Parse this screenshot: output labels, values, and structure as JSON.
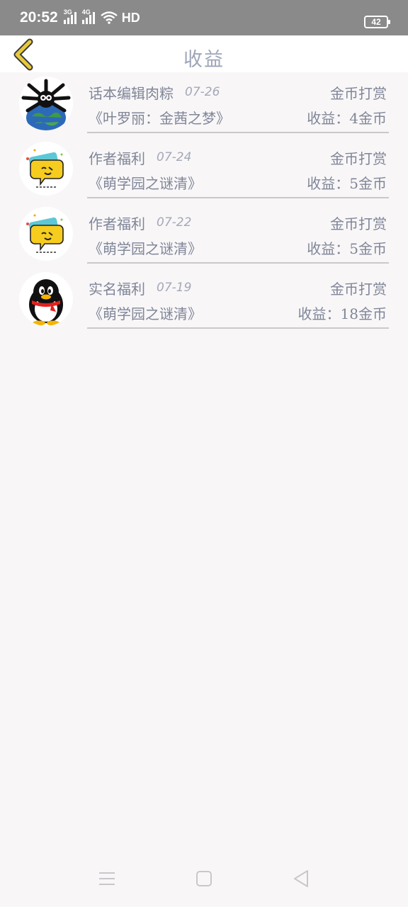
{
  "status_bar": {
    "time": "20:52",
    "signal1_tag": "3G",
    "signal2_tag": "4G",
    "hd_label": "HD",
    "battery": "42"
  },
  "header": {
    "title": "收益",
    "back_icon": "chevron-left-icon",
    "accent_color": "#e8c93a"
  },
  "records": [
    {
      "avatar": "spiky-earth-avatar",
      "sender": "话本编辑肉粽",
      "date": "07-26",
      "type": "金币打赏",
      "book": "《叶罗丽：金茜之梦》",
      "income": "收益：4金币"
    },
    {
      "avatar": "chat-bubble-avatar",
      "sender": "作者福利",
      "date": "07-24",
      "type": "金币打赏",
      "book": "《萌学园之谜清》",
      "income": "收益：5金币"
    },
    {
      "avatar": "chat-bubble-avatar",
      "sender": "作者福利",
      "date": "07-22",
      "type": "金币打赏",
      "book": "《萌学园之谜清》",
      "income": "收益：5金币"
    },
    {
      "avatar": "qq-penguin-avatar",
      "sender": "实名福利",
      "date": "07-19",
      "type": "金币打赏",
      "book": "《萌学园之谜清》",
      "income": "收益：18金币"
    }
  ],
  "nav": {
    "menu_icon": "menu-icon",
    "home_icon": "home-square-icon",
    "back_icon": "back-triangle-icon"
  }
}
